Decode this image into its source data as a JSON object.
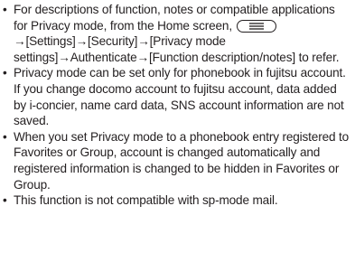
{
  "notes": [
    {
      "pre": "For descriptions of function, notes or compatible applications for Privacy mode, from the Home screen, ",
      "icon": "menu-key-icon",
      "post": "→[Settings]→[Security]→[Privacy mode settings]→Authenticate→[Function description/notes] to refer."
    },
    {
      "text": "Privacy mode can be set only for phonebook in fujitsu account. If you change docomo account to fujitsu account, data added by i-concier, name card data, SNS account information are not saved."
    },
    {
      "text": "When you set Privacy mode to a phonebook entry registered to Favorites or Group, account is changed automatically and registered information is changed to be hidden in Favorites or Group."
    },
    {
      "text": "This function is not compatible with sp-mode mail."
    }
  ],
  "bullet_glyph": "•"
}
